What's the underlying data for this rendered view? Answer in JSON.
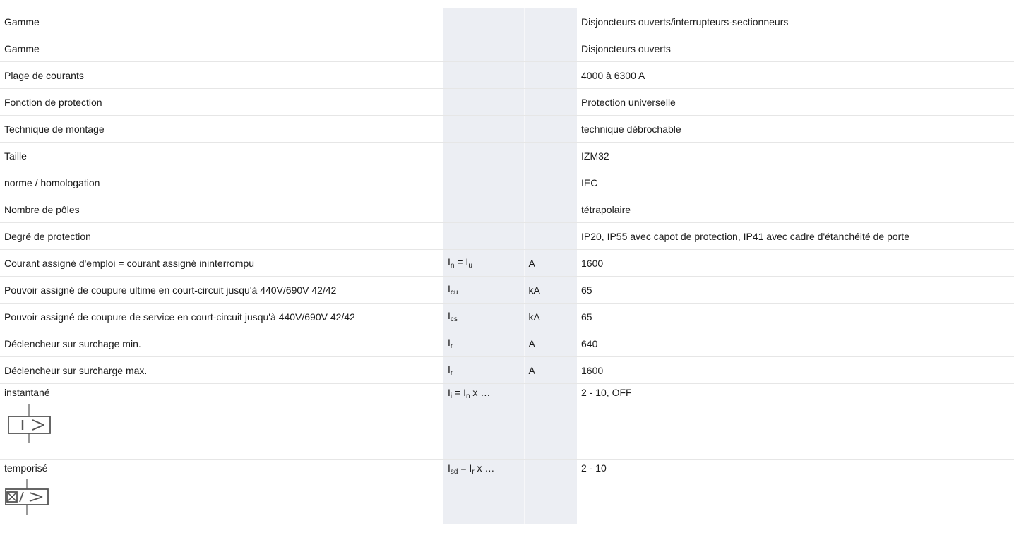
{
  "rows": [
    {
      "label": "Gamme",
      "sym": "",
      "sub": "",
      "suffix": "",
      "unit": "",
      "value": "Disjoncteurs ouverts/interrupteurs-sectionneurs"
    },
    {
      "label": "Gamme",
      "sym": "",
      "sub": "",
      "suffix": "",
      "unit": "",
      "value": "Disjoncteurs ouverts"
    },
    {
      "label": "Plage de courants",
      "sym": "",
      "sub": "",
      "suffix": "",
      "unit": "",
      "value": "4000 à 6300 A"
    },
    {
      "label": "Fonction de protection",
      "sym": "",
      "sub": "",
      "suffix": "",
      "unit": "",
      "value": "Protection universelle"
    },
    {
      "label": "Technique de montage",
      "sym": "",
      "sub": "",
      "suffix": "",
      "unit": "",
      "value": "technique débrochable"
    },
    {
      "label": "Taille",
      "sym": "",
      "sub": "",
      "suffix": "",
      "unit": "",
      "value": "IZM32"
    },
    {
      "label": "norme / homologation",
      "sym": "",
      "sub": "",
      "suffix": "",
      "unit": "",
      "value": "IEC"
    },
    {
      "label": "Nombre de pôles",
      "sym": "",
      "sub": "",
      "suffix": "",
      "unit": "",
      "value": "tétrapolaire"
    },
    {
      "label": "Degré de protection",
      "sym": "",
      "sub": "",
      "suffix": "",
      "unit": "",
      "value": "IP20, IP55 avec capot de protection, IP41 avec cadre d'étanchéité de porte"
    },
    {
      "label": "Courant assigné d'emploi = courant assigné ininterrompu",
      "sym": "I",
      "sub": "n",
      "suffix": " = I",
      "sub2": "u",
      "unit": "A",
      "value": "1600"
    },
    {
      "label": "Pouvoir assigné de coupure ultime en court-circuit jusqu'à 440V/690V 42/42",
      "sym": "I",
      "sub": "cu",
      "suffix": "",
      "sub2": "",
      "unit": "kA",
      "value": "65"
    },
    {
      "label": "Pouvoir assigné de coupure de service en court-circuit jusqu'à 440V/690V 42/42",
      "sym": "I",
      "sub": "cs",
      "suffix": "",
      "sub2": "",
      "unit": "kA",
      "value": "65"
    },
    {
      "label": "Déclencheur sur surchage min.",
      "sym": "I",
      "sub": "r",
      "suffix": "",
      "sub2": "",
      "unit": "A",
      "value": "640"
    },
    {
      "label": "Déclencheur sur surcharge max.",
      "sym": "I",
      "sub": "r",
      "suffix": "",
      "sub2": "",
      "unit": "A",
      "value": "1600"
    }
  ],
  "instant": {
    "label": "instantané",
    "sym": "I",
    "sub": "i",
    "mid": " = I",
    "sub2": "n",
    "tail": " x …",
    "unit": "",
    "value": "2 - 10, OFF",
    "icon": "instantaneous-trip-symbol-icon"
  },
  "delayed": {
    "label": "temporisé",
    "sym": "I",
    "sub": "sd",
    "mid": " = I",
    "sub2": "r",
    "tail": " x …",
    "unit": "",
    "value": "2 - 10",
    "icon": "delayed-trip-symbol-icon"
  }
}
